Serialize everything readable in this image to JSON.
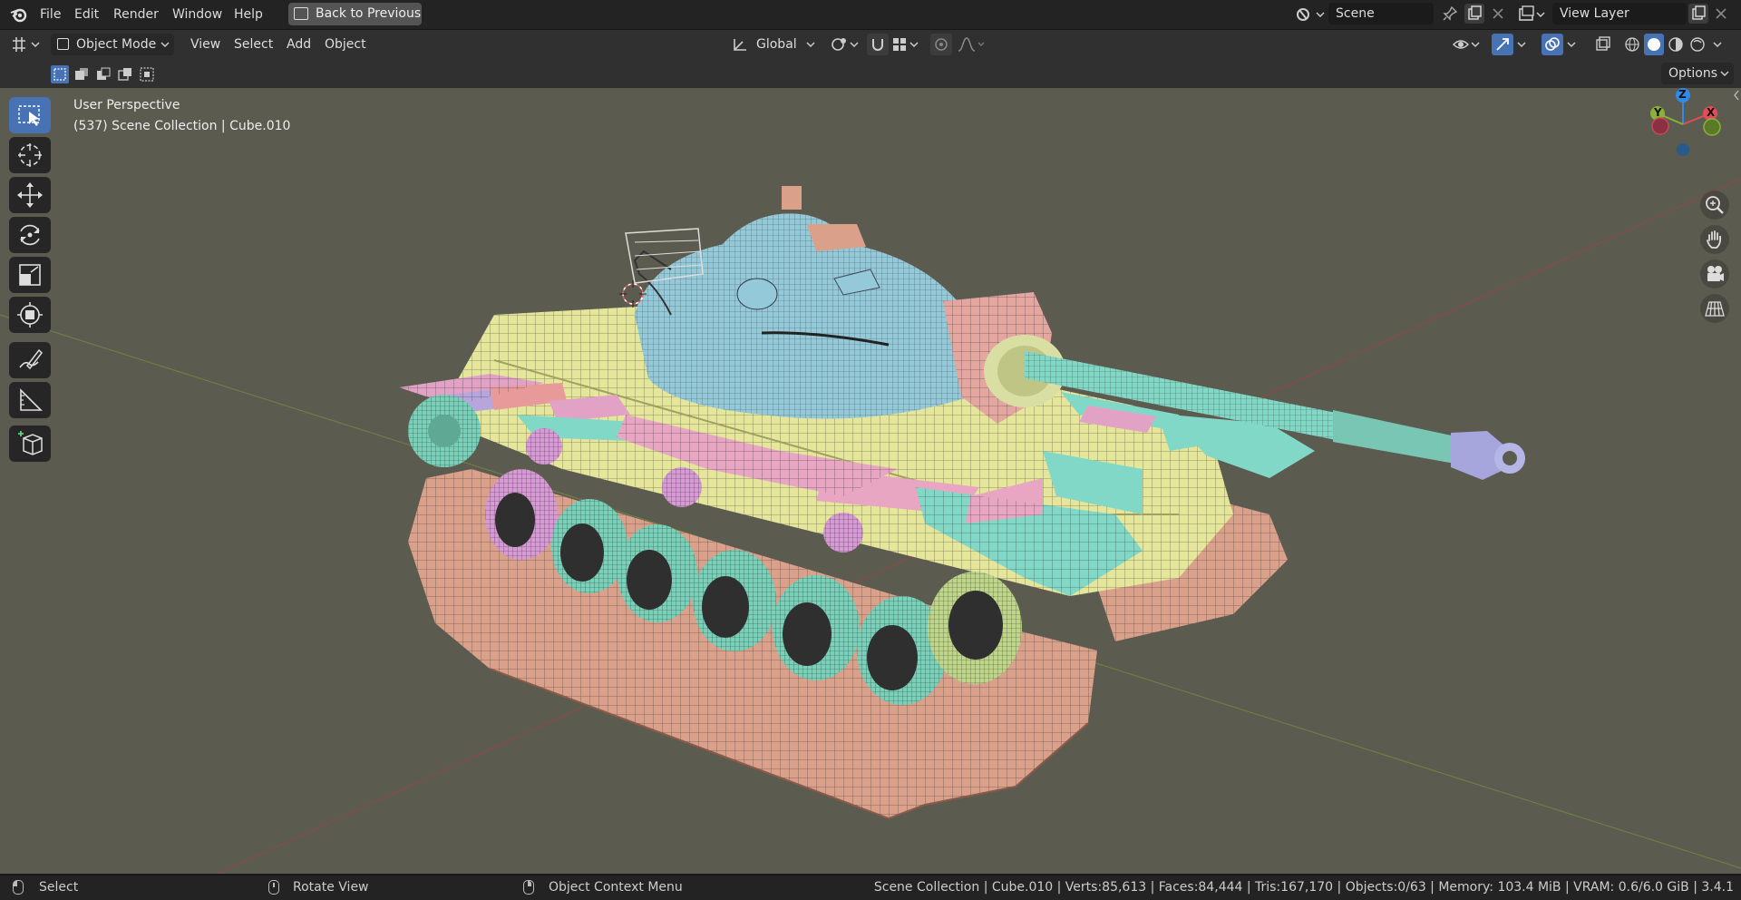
{
  "menu": {
    "file": "File",
    "edit": "Edit",
    "render": "Render",
    "window": "Window",
    "help": "Help",
    "back_to_previous": "Back to Previous"
  },
  "scene_field": {
    "value": "Scene"
  },
  "view_layer_field": {
    "value": "View Layer"
  },
  "header": {
    "mode": "Object Mode",
    "view": "View",
    "select": "Select",
    "add": "Add",
    "object": "Object",
    "transform_orientation": "Global"
  },
  "options_button": "Options",
  "viewport": {
    "perspective_label": "User Perspective",
    "collection_label": "(537) Scene Collection | Cube.010",
    "axis_z": "Z",
    "axis_y": "Y",
    "axis_x": "X"
  },
  "status": {
    "select": "Select",
    "rotate_view": "Rotate View",
    "context_menu": "Object Context Menu",
    "stats": "Scene Collection | Cube.010 | Verts:85,613 | Faces:84,444 | Tris:167,170 | Objects:0/63 | Memory: 103.4 MiB | VRAM: 0.6/6.0 GiB | 3.4.1"
  },
  "colors": {
    "viewport_bg": "#5b5b4f",
    "accent_blue": "#4772b3",
    "axis_x": "#e44b5a",
    "axis_y": "#8ab238",
    "axis_z": "#2d8ceb"
  }
}
